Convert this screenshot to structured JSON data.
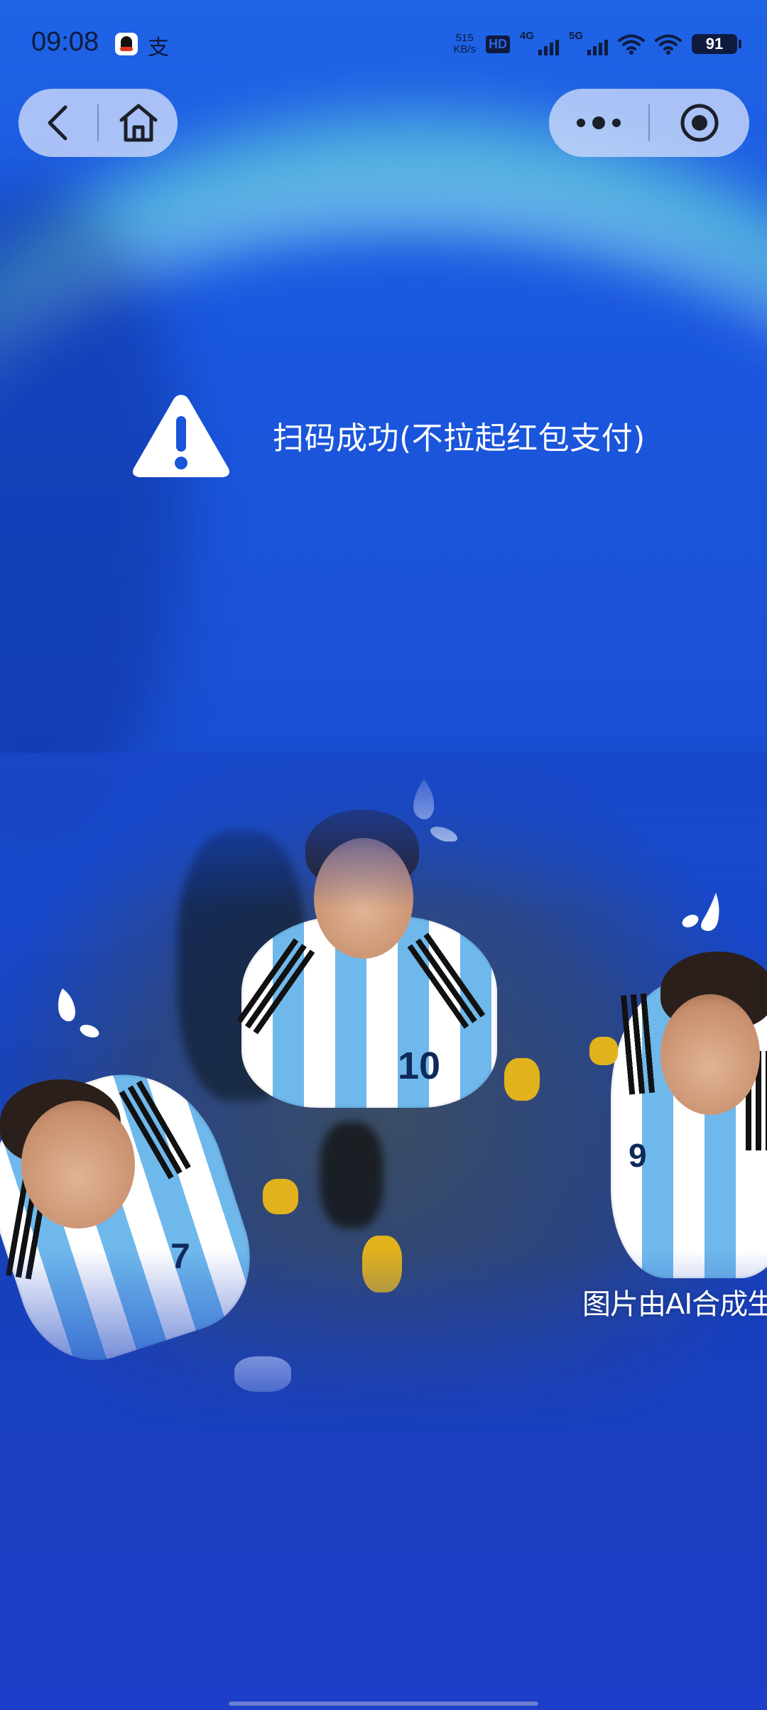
{
  "status_bar": {
    "time": "09:08",
    "network_speed_value": "515",
    "network_speed_unit": "KB/s",
    "hd_badge": "HD",
    "hd_sim": "1 2",
    "signal_4g": "4G",
    "signal_5g": "5G",
    "battery_level": "91",
    "alipay_glyph": "支"
  },
  "nav_capsule": {
    "back": "back-icon",
    "home": "home-icon"
  },
  "menu_capsule": {
    "more": "more-icon",
    "close": "target-icon"
  },
  "message": {
    "icon": "warning-icon",
    "text": "扫码成功(不拉起红包支付)"
  },
  "photo": {
    "caption": "图片由AI合成生成",
    "jersey_numbers": [
      "10",
      "7",
      "9"
    ]
  },
  "colors": {
    "background": "#1a52d6",
    "glow": "#78f0dc",
    "capsule": "#c8d7fa",
    "text": "#ffffff"
  }
}
